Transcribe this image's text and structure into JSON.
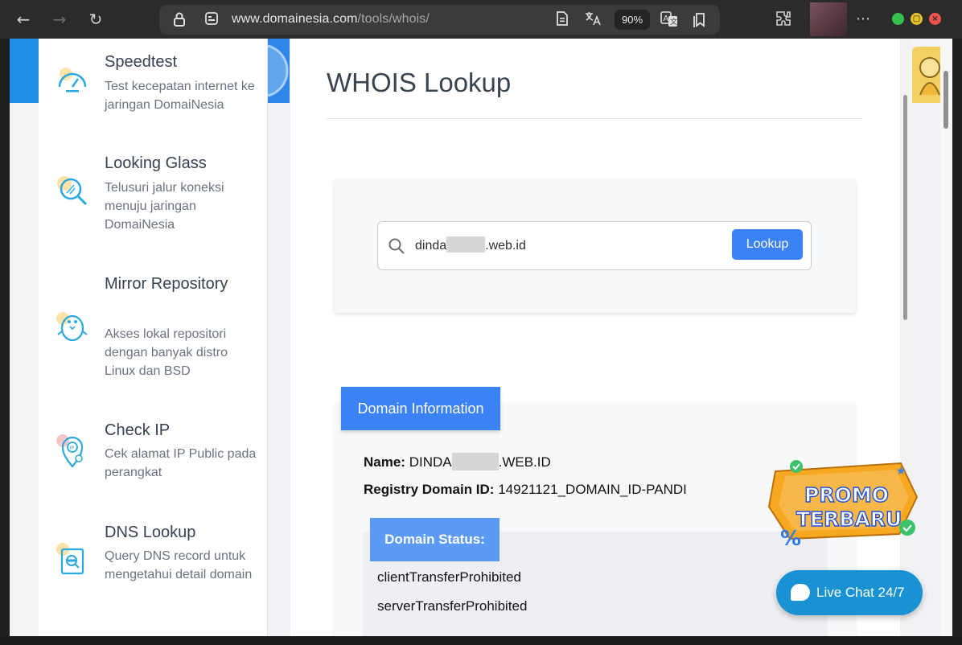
{
  "browser": {
    "url_host": "www.domainesia.com",
    "url_path": "/tools/whois/",
    "zoom": "90%",
    "back_icon": "back-arrow-icon",
    "forward_icon": "forward-arrow-icon",
    "reload_icon": "reload-icon"
  },
  "sidebar": {
    "items": [
      {
        "title": "Speedtest",
        "desc": "Test kecepatan internet ke jaringan DomaiNesia",
        "icon": "speedometer-icon"
      },
      {
        "title": "Looking Glass",
        "desc": "Telusuri jalur koneksi menuju jaringan DomaiNesia",
        "icon": "magnifier-icon"
      },
      {
        "title": "Mirror Repository",
        "desc": "Akses lokal repositori dengan banyak distro Linux dan BSD",
        "icon": "penguin-icon"
      },
      {
        "title": "Check IP",
        "desc": "Cek alamat IP Public pada perangkat",
        "icon": "location-pin-icon"
      },
      {
        "title": "DNS Lookup",
        "desc": "Query DNS record untuk mengetahui detail domain",
        "icon": "dns-search-icon"
      }
    ]
  },
  "main": {
    "title": "WHOIS Lookup",
    "search": {
      "value_prefix": "dinda",
      "value_suffix": ".web.id",
      "button": "Lookup"
    },
    "domain_info": {
      "tab": "Domain Information",
      "name_label": "Name:",
      "name_prefix": "DINDA",
      "name_suffix": ".WEB.ID",
      "registry_label": "Registry Domain ID:",
      "registry_value": "14921121_DOMAIN_ID-PANDI"
    },
    "domain_status": {
      "tab": "Domain Status:",
      "items": [
        "clientTransferProhibited",
        "serverTransferProhibited"
      ]
    }
  },
  "promo": {
    "line1": "PROMO",
    "line2": "TERBARU"
  },
  "livechat": {
    "label": "Live Chat 24/7"
  }
}
